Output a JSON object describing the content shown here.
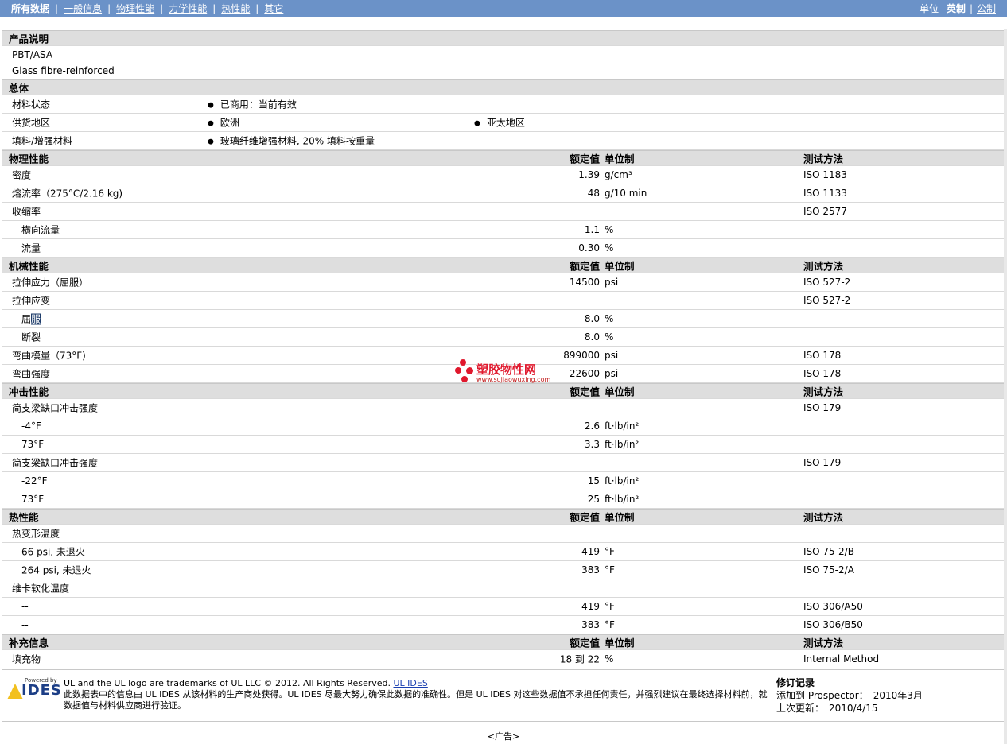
{
  "nav": {
    "items": [
      {
        "label": "所有数据",
        "current": true
      },
      {
        "label": "一般信息"
      },
      {
        "label": "物理性能"
      },
      {
        "label": "力学性能"
      },
      {
        "label": "热性能"
      },
      {
        "label": "其它"
      }
    ],
    "units_label": "单位",
    "unit_options": [
      {
        "label": "英制",
        "current": true
      },
      {
        "label": "公制"
      }
    ],
    "separator": "|"
  },
  "product_description": {
    "title": "产品说明",
    "lines": [
      "PBT/ASA",
      "Glass fibre-reinforced"
    ]
  },
  "general": {
    "title": "总体",
    "rows": [
      {
        "label": "材料状态",
        "values": [
          "已商用：当前有效"
        ]
      },
      {
        "label": "供货地区",
        "values": [
          "欧洲",
          "亚太地区"
        ]
      },
      {
        "label": "填料/增强材料",
        "values": [
          "玻璃纤维增强材料, 20% 填料按重量"
        ]
      }
    ]
  },
  "headers": {
    "nominal": "额定值",
    "unit": "单位制",
    "method": "测试方法"
  },
  "physical": {
    "title": "物理性能",
    "rows": [
      {
        "label": "密度",
        "value": "1.39",
        "unit": "g/cm³",
        "method": "ISO 1183"
      },
      {
        "label": "熔流率（275°C/2.16 kg)",
        "value": "48",
        "unit": "g/10 min",
        "method": "ISO 1133"
      },
      {
        "label": "收缩率",
        "value": "",
        "unit": "",
        "method": "ISO 2577"
      },
      {
        "label": "横向流量",
        "value": "1.1",
        "unit": "%",
        "method": "",
        "indent": true
      },
      {
        "label": "流量",
        "value": "0.30",
        "unit": "%",
        "method": "",
        "indent": true
      }
    ]
  },
  "mechanical": {
    "title": "机械性能",
    "rows": [
      {
        "label": "拉伸应力（屈服）",
        "value": "14500",
        "unit": "psi",
        "method": "ISO 527-2"
      },
      {
        "label": "拉伸应变",
        "value": "",
        "unit": "",
        "method": "ISO 527-2"
      },
      {
        "label_a": "屈",
        "label_b": "服",
        "value": "8.0",
        "unit": "%",
        "method": "",
        "indent": true
      },
      {
        "label": "断裂",
        "value": "8.0",
        "unit": "%",
        "method": "",
        "indent": true
      },
      {
        "label": "弯曲模量（73°F)",
        "value": "899000",
        "unit": "psi",
        "method": "ISO 178"
      },
      {
        "label": "弯曲强度",
        "value": "22600",
        "unit": "psi",
        "method": "ISO 178"
      }
    ]
  },
  "impact": {
    "title": "冲击性能",
    "rows": [
      {
        "label": "简支梁缺口冲击强度",
        "value": "",
        "unit": "",
        "method": "ISO 179"
      },
      {
        "label": "-4°F",
        "value": "2.6",
        "unit": "ft·lb/in²",
        "method": "",
        "indent": true
      },
      {
        "label": "73°F",
        "value": "3.3",
        "unit": "ft·lb/in²",
        "method": "",
        "indent": true
      },
      {
        "label": "简支梁缺口冲击强度",
        "value": "",
        "unit": "",
        "method": "ISO 179"
      },
      {
        "label": "-22°F",
        "value": "15",
        "unit": "ft·lb/in²",
        "method": "",
        "indent": true
      },
      {
        "label": "73°F",
        "value": "25",
        "unit": "ft·lb/in²",
        "method": "",
        "indent": true
      }
    ]
  },
  "thermal": {
    "title": "热性能",
    "rows": [
      {
        "label": "热变形温度",
        "value": "",
        "unit": "",
        "method": ""
      },
      {
        "label": "66 psi, 未退火",
        "value": "419",
        "unit": "°F",
        "method": "ISO 75-2/B",
        "indent": true
      },
      {
        "label": "264 psi, 未退火",
        "value": "383",
        "unit": "°F",
        "method": "ISO 75-2/A",
        "indent": true
      },
      {
        "label": "维卡软化温度",
        "value": "",
        "unit": "",
        "method": ""
      },
      {
        "label": "--",
        "value": "419",
        "unit": "°F",
        "method": "ISO 306/A50",
        "indent": true
      },
      {
        "label": "--",
        "value": "383",
        "unit": "°F",
        "method": "ISO 306/B50",
        "indent": true
      }
    ]
  },
  "supplement": {
    "title": "补充信息",
    "rows": [
      {
        "label": "填充物",
        "value": "18 到  22",
        "unit": "%",
        "method": "Internal Method"
      }
    ]
  },
  "watermark": {
    "title": "塑胶物性网",
    "url": "www.sujiaowuxing.com"
  },
  "footer": {
    "logo_powered": "Powered by",
    "logo_text": "IDES",
    "trademark": "UL and the UL logo are trademarks of UL LLC © 2012. All Rights Reserved.",
    "link": "UL IDES",
    "disclaimer": "此数据表中的信息由  UL IDES 从该材料的生产商处获得。UL IDES 尽最大努力确保此数据的准确性。但是  UL IDES 对这些数据值不承担任何责任，并强烈建议在最终选择材料前，就数据值与材料供应商进行验证。",
    "revision": {
      "title": "修订记录",
      "added_label": "添加到 Prospector：",
      "added_value": "2010年3月",
      "updated_label": "上次更新：",
      "updated_value": "2010/4/15"
    },
    "ad": "<广告>"
  }
}
